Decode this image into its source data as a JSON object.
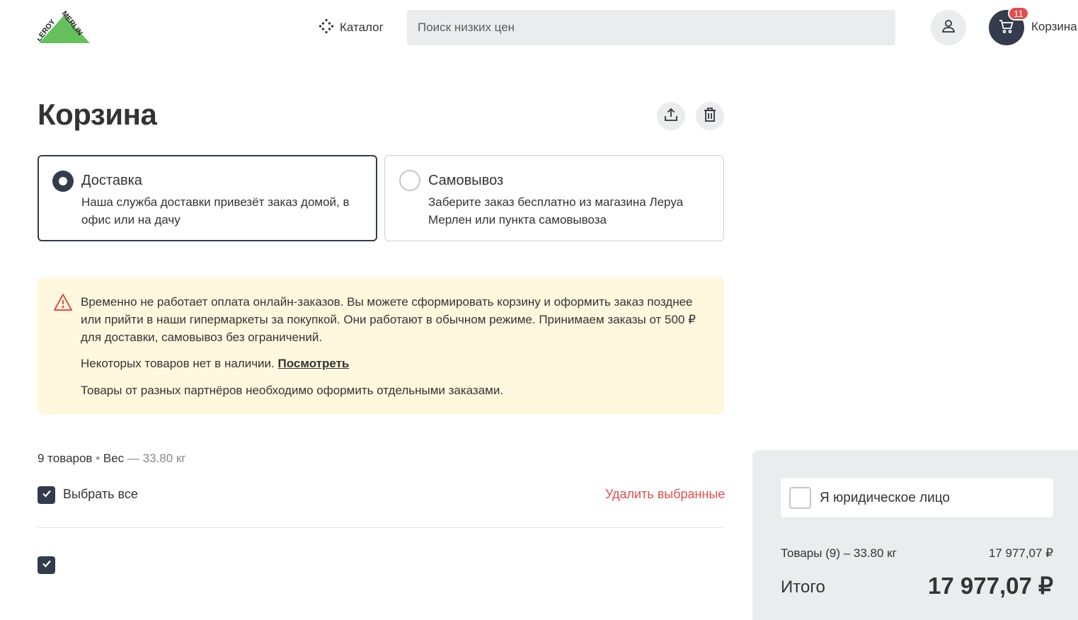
{
  "header": {
    "logo_text_top": "LEROY",
    "logo_text_bottom": "MERLIN",
    "catalog_label": "Каталог",
    "search_placeholder": "Поиск низких цен",
    "cart_count": "11",
    "cart_label": "Корзина"
  },
  "page": {
    "title": "Корзина"
  },
  "delivery_options": [
    {
      "title": "Доставка",
      "description": "Наша служба доставки привезёт заказ домой, в офис или на дачу",
      "selected": true
    },
    {
      "title": "Самовывоз",
      "description": "Заберите заказ бесплатно из магазина Леруа Мерлен или пункта самовывоза",
      "selected": false
    }
  ],
  "notice": {
    "message": "Временно не работает оплата онлайн-заказов. Вы можете сформировать корзину и оформить заказ позднее или прийти в наши гипермаркеты за покупкой. Они работают в обычном режиме. Принимаем заказы от 500 ₽ для доставки, самовывоз без ограничений.",
    "unavailable_text": "Некоторых товаров нет в наличии.",
    "unavailable_link": "Посмотреть",
    "partners_text": "Товары от разных партнёров необходимо оформить отдельными заказами."
  },
  "cart_summary": {
    "items_count": "9 товаров",
    "separator": "•",
    "weight_label": "Вес",
    "weight_value": "— 33.80 кг",
    "select_all_label": "Выбрать все",
    "delete_selected_label": "Удалить выбранные"
  },
  "order_panel": {
    "legal_entity_label": "Я юридическое лицо",
    "goods_label": "Товары (9) – 33.80 кг",
    "goods_value": "17 977,07 ₽",
    "total_label": "Итого",
    "total_value": "17 977,07 ₽"
  },
  "colors": {
    "brand_green": "#66c05d",
    "dark": "#333b4c",
    "accent_red": "#e04f4f",
    "notice_bg": "#fff8de"
  }
}
